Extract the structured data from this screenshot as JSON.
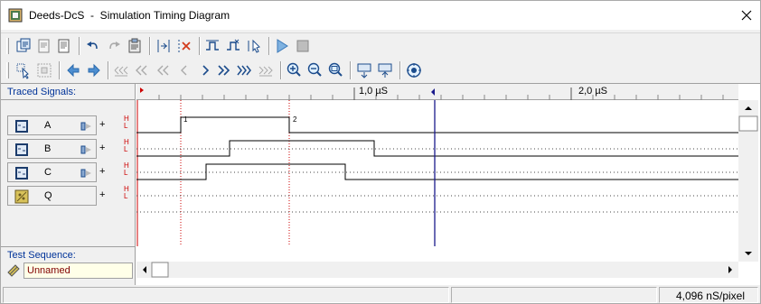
{
  "window": {
    "title": "Deeds-DcS  -  Simulation Timing Diagram",
    "close_symbol": "✕"
  },
  "toolbar1": {
    "icons": [
      "copy-diagram-icon",
      "print-preview-icon",
      "page-icon",
      "undo-icon",
      "redo-icon",
      "clipboard-icon",
      "add-signal-icon",
      "delete-signal-icon",
      "insert-step-icon",
      "remove-step-icon",
      "cursor-tool-icon",
      "run-simulation-icon",
      "stop-simulation-icon"
    ]
  },
  "toolbar2": {
    "icons": [
      "select-signal-icon",
      "select-all-icon",
      "back-icon",
      "forward-icon",
      "first-icon",
      "fast-rewind-icon",
      "rewind-icon",
      "step-back-icon",
      "step-forward-icon",
      "fast-forward-icon",
      "last-icon",
      "zoom-in-icon",
      "zoom-out-icon",
      "zoom-fit-icon",
      "expand-icon",
      "collapse-icon",
      "settings-icon"
    ]
  },
  "traced_signals": {
    "label": "Traced Signals:"
  },
  "ruler": {
    "labels": [
      "1,0 µS",
      "2,0 µS"
    ]
  },
  "signals": [
    {
      "name": "A",
      "plus": "+",
      "hl": "H\nL"
    },
    {
      "name": "B",
      "plus": "+",
      "hl": "H\nL"
    },
    {
      "name": "C",
      "plus": "+",
      "hl": "H\nL"
    },
    {
      "name": "Q",
      "plus": "+",
      "hl": "H\nL"
    }
  ],
  "markers": {
    "m1": "1",
    "m2": "2"
  },
  "test_sequence": {
    "label": "Test Sequence:",
    "name": "Unnamed"
  },
  "status": {
    "zoom": "4,096 nS/pixel"
  },
  "colors": {
    "accent": "#003399",
    "signal": "#000000",
    "cursor": "#1a1a8c",
    "hl_label": "#cc0000",
    "seq_name": "#800000"
  }
}
